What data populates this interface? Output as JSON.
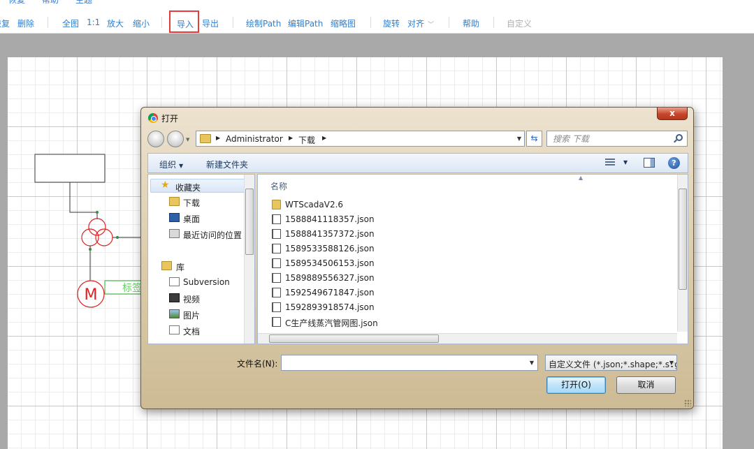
{
  "top_menu": [
    "恢复",
    "帮助",
    "主题"
  ],
  "toolbar": {
    "redo": "恢复",
    "delete": "删除",
    "fit": "全图",
    "actual": "1:1",
    "zoom_in": "放大",
    "zoom_out": "缩小",
    "import": "导入",
    "export": "导出",
    "draw_path": "绘制Path",
    "edit_path": "编辑Path",
    "thumbnail": "缩略图",
    "rotate": "旋转",
    "align": "对齐",
    "help": "帮助",
    "custom": "自定义"
  },
  "diagram": {
    "label_text": "标签",
    "motor_label": "M"
  },
  "dialog": {
    "title": "打开",
    "close_label": "x",
    "breadcrumbs": [
      "Administrator",
      "下载"
    ],
    "search_placeholder": "搜索 下载",
    "organize": "组织",
    "new_folder": "新建文件夹",
    "help_symbol": "?",
    "nav": {
      "favorites": "收藏夹",
      "downloads": "下载",
      "desktop": "桌面",
      "recent": "最近访问的位置",
      "libraries": "库",
      "subversion": "Subversion",
      "videos": "视频",
      "pictures": "图片",
      "documents": "文档"
    },
    "column_name": "名称",
    "files": [
      {
        "name": "WTScadaV2.6",
        "type": "folder"
      },
      {
        "name": "1588841118357.json",
        "type": "file"
      },
      {
        "name": "1588841357372.json",
        "type": "file"
      },
      {
        "name": "1589533588126.json",
        "type": "file"
      },
      {
        "name": "1589534506153.json",
        "type": "file"
      },
      {
        "name": "1589889556327.json",
        "type": "file"
      },
      {
        "name": "1592549671847.json",
        "type": "file"
      },
      {
        "name": "1592893918574.json",
        "type": "file"
      },
      {
        "name": "C生产线蒸汽管网图.json",
        "type": "file"
      }
    ],
    "filename_label": "文件名(N):",
    "filename_value": "",
    "filter": "自定义文件 (*.json;*.shape;*.svg)",
    "open_button": "打开(O)",
    "cancel_button": "取消"
  }
}
